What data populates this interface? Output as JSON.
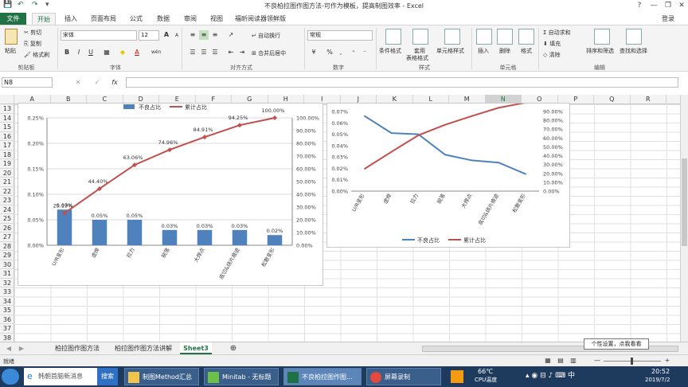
{
  "window": {
    "title": "不良柏拉图作图方法-可作为模板，提高制图效率 - Excel",
    "login": "登录",
    "help": "?",
    "min": "—",
    "max": "❐",
    "close": "✕"
  },
  "tabs": [
    "文件",
    "开始",
    "插入",
    "页面布局",
    "公式",
    "数据",
    "审阅",
    "视图",
    "福昕阅读器领鲜版"
  ],
  "ribbon": {
    "clipboard": {
      "paste": "粘贴",
      "cut": "剪切",
      "copy": "复制",
      "format_painter": "格式刷",
      "label": "剪贴板"
    },
    "font": {
      "name": "宋体",
      "size": "12",
      "bold": "B",
      "italic": "I",
      "underline": "U",
      "grow": "A",
      "shrink": "A",
      "wen": "wén",
      "label": "字体"
    },
    "alignment": {
      "wrap": "自动换行",
      "merge": "合并后居中",
      "label": "对齐方式"
    },
    "number": {
      "format": "常规",
      "currency": "¥",
      "percent": "%",
      "comma": ",",
      "label": "数字"
    },
    "styles": {
      "conditional": "条件格式",
      "table1": "套用",
      "table2": "表格格式",
      "cell_styles": "单元格样式",
      "label": "样式"
    },
    "cells": {
      "insert": "插入",
      "delete": "删除",
      "format": "格式",
      "label": "单元格"
    },
    "editing": {
      "autosum": "自动求和",
      "fill": "填充",
      "clear": "清除",
      "sort": "排序和筛选",
      "find": "查找和选择",
      "label": "编辑"
    }
  },
  "formula_bar": {
    "namebox": "N8",
    "cancel": "✕",
    "enter": "✓",
    "fx": "fx",
    "value": ""
  },
  "columns": [
    "A",
    "B",
    "C",
    "D",
    "E",
    "F",
    "G",
    "H",
    "I",
    "J",
    "K",
    "L",
    "M",
    "N",
    "O",
    "P",
    "Q",
    "R"
  ],
  "selected_column": "N",
  "rows": [
    "13",
    "14",
    "15",
    "16",
    "17",
    "18",
    "19",
    "20",
    "21",
    "22",
    "23",
    "24",
    "25",
    "26",
    "27",
    "28",
    "29",
    "30",
    "31",
    "32",
    "33",
    "34",
    "35",
    "36",
    "37",
    "38"
  ],
  "chart_data": [
    {
      "type": "bar",
      "categories": [
        "U/R变形",
        "虚焊",
        "拉力",
        "脱落",
        "大焊点",
        "底切&烧片痕迹",
        "松散变形"
      ],
      "series": [
        {
          "name": "不良占比",
          "type": "bar",
          "values": [
            0.07,
            0.05,
            0.05,
            0.03,
            0.03,
            0.03,
            0.02
          ],
          "labels": [
            "0.07%",
            "0.05%",
            "0.05%",
            "0.03%",
            "0.03%",
            "0.03%",
            "0.02%"
          ],
          "color": "#4f81bd"
        },
        {
          "name": "累计占比",
          "type": "line",
          "axis": "right",
          "values": [
            25.19,
            44.4,
            63.06,
            74.96,
            84.91,
            94.25,
            100.0
          ],
          "labels": [
            "25.19%",
            "44.40%",
            "63.06%",
            "74.96%",
            "84.91%",
            "94.25%",
            "100.00%"
          ],
          "color": "#c0504d"
        }
      ],
      "ylim": [
        0,
        0.25
      ],
      "y_ticks": [
        "0.00%",
        "0.05%",
        "0.10%",
        "0.15%",
        "0.20%",
        "0.25%"
      ],
      "y2lim": [
        0,
        100
      ],
      "y2_ticks": [
        "0.00%",
        "10.00%",
        "20.00%",
        "30.00%",
        "40.00%",
        "50.00%",
        "60.00%",
        "70.00%",
        "80.00%",
        "90.00%",
        "100.00%"
      ],
      "legend": "top",
      "grid": true
    },
    {
      "type": "line",
      "categories": [
        "U/R变形",
        "虚焊",
        "拉力",
        "脱落",
        "大焊点",
        "底切&烧片痕迹",
        "松散变形"
      ],
      "series": [
        {
          "name": "不良占比",
          "values": [
            0.066,
            0.051,
            0.05,
            0.032,
            0.027,
            0.025,
            0.015
          ],
          "color": "#4f81bd"
        },
        {
          "name": "累计占比",
          "axis": "right",
          "values": [
            25.19,
            44.4,
            63.06,
            74.96,
            84.91,
            94.25,
            100.0
          ],
          "color": "#c0504d"
        }
      ],
      "ylim": [
        0,
        0.07
      ],
      "y_ticks": [
        "0.00%",
        "0.01%",
        "0.02%",
        "0.03%",
        "0.04%",
        "0.05%",
        "0.06%",
        "0.07%"
      ],
      "y2lim": [
        0,
        90
      ],
      "y2_ticks": [
        "0.00%",
        "10.00%",
        "20.00%",
        "30.00%",
        "40.00%",
        "50.00%",
        "60.00%",
        "70.00%",
        "80.00%",
        "90.00%"
      ],
      "legend": "bottom",
      "grid": false
    }
  ],
  "sheets": [
    "柏拉图作图方法",
    "柏拉图作图方法讲解",
    "Sheet3"
  ],
  "active_sheet": "Sheet3",
  "status": {
    "ready": "就绪",
    "zoom_minus": "—",
    "zoom_plus": "+"
  },
  "tooltip": "个性设置，点我看看",
  "taskbar": {
    "ie_text": "韩朝首脑新消息",
    "search": "搜索",
    "items": [
      "制图Method汇总",
      "Minitab - 无标题",
      "不良柏拉图作图...",
      "屏幕录制"
    ],
    "temp": "66℃",
    "cpu": "CPU温度",
    "time": "20:52",
    "date": "2019/7/2"
  }
}
